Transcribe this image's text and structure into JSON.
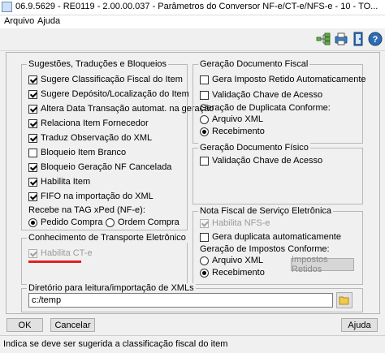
{
  "window": {
    "title": "06.9.5629 - RE0119 - 2.00.00.037 - Parâmetros do Conversor NF-e/CT-e/NFS-e - 10 - TO..."
  },
  "menu": {
    "items": [
      {
        "label": "Arquivo"
      },
      {
        "label": "Ajuda"
      }
    ]
  },
  "toolbar": {
    "icons": [
      "tree-icon",
      "printer-icon",
      "exit-door-icon",
      "help-icon"
    ]
  },
  "sugestoes": {
    "legend": "Sugestões, Traduções e Bloqueios",
    "items": [
      {
        "label": "Sugere Classificação Fiscal do Item",
        "checked": true
      },
      {
        "label": "Sugere Depósito/Localização do Item",
        "checked": true
      },
      {
        "label": "Altera Data Transação automat. na geração",
        "checked": true
      },
      {
        "label": "Relaciona Item Fornecedor",
        "checked": true
      },
      {
        "label": "Traduz Observação do XML",
        "checked": true
      },
      {
        "label": "Bloqueio Item Branco",
        "checked": false
      },
      {
        "label": "Bloqueio Geração NF Cancelada",
        "checked": true
      },
      {
        "label": "Habilita Item",
        "checked": true
      },
      {
        "label": "FIFO na importação do XML",
        "checked": true
      }
    ],
    "xped_label": "Recebe na TAG xPed (NF-e):",
    "xped_options": [
      {
        "label": "Pedido Compra",
        "checked": true
      },
      {
        "label": "Ordem Compra",
        "checked": false
      }
    ]
  },
  "transporte": {
    "legend": "Conhecimento de Transporte Eletrônico",
    "habilita_cte": {
      "label": "Habilita CT-e",
      "checked": true,
      "disabled": true
    }
  },
  "geracao_fiscal": {
    "legend": "Geração Documento Fiscal",
    "items": [
      {
        "label": "Gera Imposto Retido Automaticamente",
        "checked": false
      },
      {
        "label": "Validação Chave de Acesso",
        "checked": false
      }
    ],
    "duplicata_label": "Geração de Duplicata Conforme:",
    "duplicata_options": [
      {
        "label": "Arquivo XML",
        "checked": false
      },
      {
        "label": "Recebimento",
        "checked": true
      }
    ]
  },
  "geracao_fisico": {
    "legend": "Geração Documento Físico",
    "items": [
      {
        "label": "Validação Chave de Acesso",
        "checked": false
      }
    ]
  },
  "nfse": {
    "legend": "Nota Fiscal de Serviço Eletrônica",
    "habilita": {
      "label": "Habilita NFS-e",
      "checked": true,
      "disabled": true
    },
    "duplicata": {
      "label": "Gera duplicata automaticamente",
      "checked": false
    },
    "impostos_label": "Geração de Impostos Conforme:",
    "impostos_options": [
      {
        "label": "Arquivo XML",
        "checked": false
      },
      {
        "label": "Recebimento",
        "checked": true
      }
    ],
    "impostos_retidos_button": "Impostos Retidos"
  },
  "diretorio": {
    "legend": "Diretório para leitura/importação de XMLs",
    "value": "c:/temp"
  },
  "buttons": {
    "ok": "OK",
    "cancel": "Cancelar",
    "help": "Ajuda"
  },
  "status": {
    "text": "Indica se deve ser sugerida a classificação fiscal do item"
  },
  "colors": {
    "annotation_underline": "#e02020"
  }
}
